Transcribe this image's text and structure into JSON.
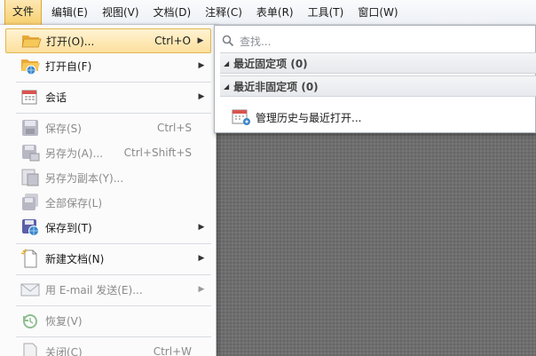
{
  "menubar": {
    "items": [
      {
        "label": "文件",
        "active": true
      },
      {
        "label": "编辑(E)"
      },
      {
        "label": "视图(V)"
      },
      {
        "label": "文档(D)"
      },
      {
        "label": "注释(C)"
      },
      {
        "label": "表单(R)"
      },
      {
        "label": "工具(T)"
      },
      {
        "label": "窗口(W)"
      }
    ]
  },
  "file_menu": {
    "open": {
      "label": "打开(O)...",
      "shortcut": "Ctrl+O"
    },
    "open_from": {
      "label": "打开自(F)"
    },
    "session": {
      "label": "会话"
    },
    "save": {
      "label": "保存(S)",
      "shortcut": "Ctrl+S"
    },
    "save_as": {
      "label": "另存为(A)...",
      "shortcut": "Ctrl+Shift+S"
    },
    "save_copy": {
      "label": "另存为副本(Y)..."
    },
    "save_all": {
      "label": "全部保存(L)"
    },
    "save_to": {
      "label": "保存到(T)"
    },
    "new_doc": {
      "label": "新建文档(N)"
    },
    "email": {
      "label": "用 E-mail 发送(E)..."
    },
    "revert": {
      "label": "恢复(V)"
    },
    "close": {
      "label": "关闭(C)",
      "shortcut": "Ctrl+W"
    }
  },
  "open_submenu": {
    "search_placeholder": "查找...",
    "pinned": "最近固定项 (0)",
    "unpinned": "最近非固定项 (0)",
    "manage": "管理历史与最近打开..."
  },
  "colors": {
    "accent": "#f7cf6e",
    "folder": "#f0b94a",
    "globe": "#3a86c9"
  }
}
